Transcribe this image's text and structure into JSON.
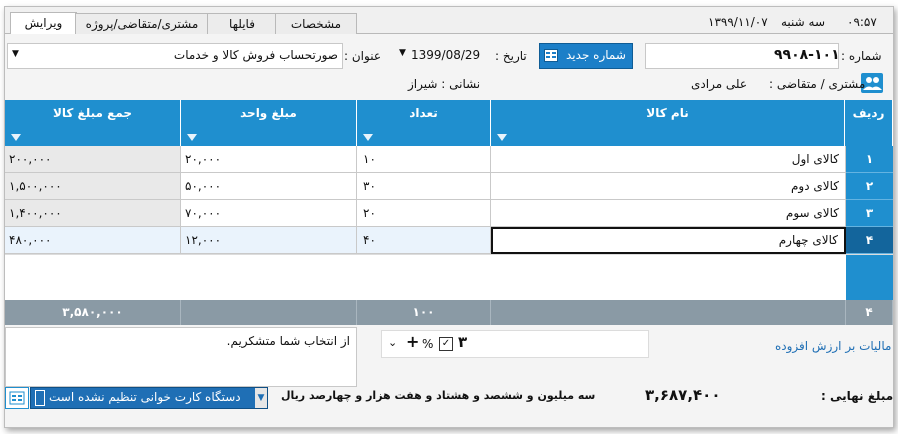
{
  "tabs": [
    "ویرایش",
    "مشتری/متقاضی/پروژه",
    "فایلها",
    "مشخصات"
  ],
  "clock": {
    "time": "۰۹:۵۷",
    "day": "سه شنبه",
    "date": "۱۳۹۹/۱۱/۰۷"
  },
  "header": {
    "number_label": "شماره :",
    "number_value": "۹۹۰۸-۱۰۱",
    "new_number_button": "شماره جدید",
    "date_label": "تاریخ :",
    "date_value": "1399/08/29",
    "title_label": "عنوان :",
    "title_value": "صورتحساب فروش کالا و خدمات"
  },
  "customer": {
    "label": "مشتری / متقاضی :",
    "name": "علی مرادی",
    "address": "نشانی : شیراز"
  },
  "grid": {
    "columns": [
      "ردیف",
      "نام کالا",
      "تعداد",
      "مبلغ واحد",
      "جمع مبلغ کالا"
    ],
    "rows": [
      {
        "row": "۱",
        "name": "کالای اول",
        "qty": "۱۰",
        "unit": "۲۰,۰۰۰",
        "total": "۲۰۰,۰۰۰"
      },
      {
        "row": "۲",
        "name": "کالای دوم",
        "qty": "۳۰",
        "unit": "۵۰,۰۰۰",
        "total": "۱,۵۰۰,۰۰۰"
      },
      {
        "row": "۳",
        "name": "کالای سوم",
        "qty": "۲۰",
        "unit": "۷۰,۰۰۰",
        "total": "۱,۴۰۰,۰۰۰"
      },
      {
        "row": "۴",
        "name": "کالای چهارم",
        "qty": "۴۰",
        "unit": "۱۲,۰۰۰",
        "total": "۴۸۰,۰۰۰"
      }
    ],
    "footer": {
      "count": "۴",
      "qty": "۱۰۰",
      "total": "۳,۵۸۰,۰۰۰"
    }
  },
  "tax": {
    "label": "مالیات بر ارزش افزوده",
    "percent": "۳",
    "percent_sign": "%",
    "plus": "+"
  },
  "note": "از انتخاب شما متشکریم.",
  "final": {
    "label": "مبلغ نهایی :",
    "value": "۳,۶۸۷,۴۰۰",
    "words": "سه میلیون و ششصد و هشتاد و هفت هزار و چهارصد ریال"
  },
  "status": {
    "card_reader": "دستگاه کارت خوانی تنظیم نشده است"
  },
  "colors": {
    "accent": "#1f8fcf",
    "footer": "#8a9aa5"
  }
}
